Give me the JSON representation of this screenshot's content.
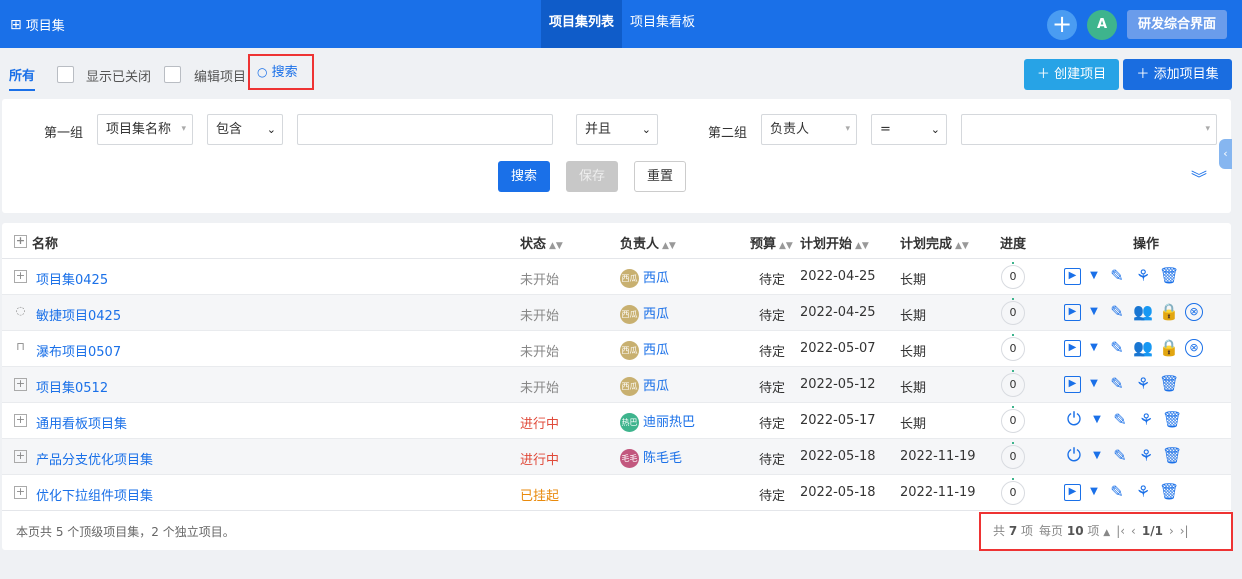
{
  "topbar": {
    "brand_icon": "grid-icon",
    "brand": "项目集",
    "tabs": [
      {
        "label": "项目集列表",
        "active": true
      },
      {
        "label": "项目集看板",
        "active": false
      }
    ],
    "add_icon": "plus-circle-icon",
    "avatar_letter": "A",
    "workspace_button": "研发综合界面"
  },
  "subbar": {
    "tab_all": "所有",
    "show_closed": "显示已关闭",
    "edit_project": "编辑项目",
    "search": "搜索",
    "create_project": "创建项目",
    "add_project_set": "添加项目集"
  },
  "filter": {
    "group1_label": "第一组",
    "group1_field": "项目集名称",
    "group1_op": "包含",
    "group1_value": "",
    "andor": "并且",
    "group2_label": "第二组",
    "group2_field": "负责人",
    "group2_op": "=",
    "group2_value": "",
    "search_btn": "搜索",
    "save_btn": "保存",
    "reset_btn": "重置"
  },
  "table": {
    "headers": {
      "name": "名称",
      "status": "状态",
      "owner": "负责人",
      "budget": "预算",
      "plan_start": "计划开始",
      "plan_end": "计划完成",
      "progress": "进度",
      "actions": "操作"
    },
    "rows": [
      {
        "name": "项目集0425",
        "status": "未开始",
        "owner": "西瓜",
        "owner_avatar": "西瓜",
        "budget": "待定",
        "start": "2022-04-25",
        "end": "长期",
        "progress": "0"
      },
      {
        "name": "敏捷项目0425",
        "status": "未开始",
        "owner": "西瓜",
        "owner_avatar": "西瓜",
        "budget": "待定",
        "start": "2022-04-25",
        "end": "长期",
        "progress": "0"
      },
      {
        "name": "瀑布项目0507",
        "status": "未开始",
        "owner": "西瓜",
        "owner_avatar": "西瓜",
        "budget": "待定",
        "start": "2022-05-07",
        "end": "长期",
        "progress": "0"
      },
      {
        "name": "项目集0512",
        "status": "未开始",
        "owner": "西瓜",
        "owner_avatar": "西瓜",
        "budget": "待定",
        "start": "2022-05-12",
        "end": "长期",
        "progress": "0"
      },
      {
        "name": "通用看板项目集",
        "status": "进行中",
        "owner": "迪丽热巴",
        "owner_avatar": "热巴",
        "budget": "待定",
        "start": "2022-05-17",
        "end": "长期",
        "progress": "0"
      },
      {
        "name": "产品分支优化项目集",
        "status": "进行中",
        "owner": "陈毛毛",
        "owner_avatar": "毛毛",
        "budget": "待定",
        "start": "2022-05-18",
        "end": "2022-11-19",
        "progress": "0"
      },
      {
        "name": "优化下拉组件项目集",
        "status": "已挂起",
        "owner": "",
        "owner_avatar": "",
        "budget": "待定",
        "start": "2022-05-18",
        "end": "2022-11-19",
        "progress": "0"
      }
    ]
  },
  "footer": {
    "summary": "本页共 5 个顶级项目集，2 个独立项目。",
    "total_prefix": "共",
    "total": "7",
    "total_suffix": "项",
    "per_page_prefix": "每页",
    "per_page": "10",
    "per_page_suffix": "项",
    "page": "1/1"
  },
  "colors": {
    "primary": "#1a70e8",
    "status_gray": "#888888",
    "status_red": "#e04a3a",
    "status_orange": "#e98a0c"
  }
}
